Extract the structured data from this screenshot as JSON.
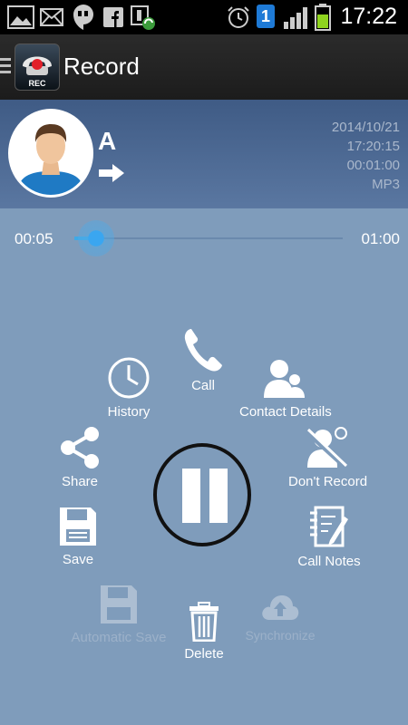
{
  "status_bar": {
    "notification_icons": [
      "gallery-icon",
      "mail-icon",
      "hangouts-icon",
      "facebook-icon",
      "sync-icon"
    ],
    "system_icons": [
      "alarm-icon",
      "sim-badge",
      "signal-icon",
      "battery-icon"
    ],
    "sim_badge": "1",
    "clock": "17:22"
  },
  "action_bar": {
    "title": "Record",
    "app_icon_label": "REC"
  },
  "call_info": {
    "contact_name": "A",
    "date": "2014/10/21",
    "time": "17:20:15",
    "duration": "00:01:00",
    "format": "MP3"
  },
  "player": {
    "elapsed": "00:05",
    "total": "01:00",
    "progress": 0.08
  },
  "actions": {
    "call": "Call",
    "history": "History",
    "contact_details": "Contact Details",
    "share": "Share",
    "dont_record": "Don't Record",
    "save": "Save",
    "call_notes": "Call Notes",
    "automatic_save": "Automatic Save",
    "delete": "Delete",
    "synchronize": "Synchronize"
  },
  "colors": {
    "accent": "#3fa9e6",
    "background": "#7f9cbb",
    "header": "#4a6690"
  }
}
